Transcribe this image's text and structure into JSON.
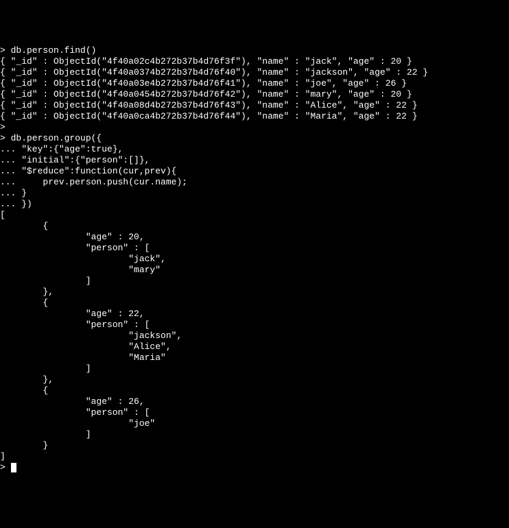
{
  "lines": [
    "> db.person.find()",
    "{ \"_id\" : ObjectId(\"4f40a02c4b272b37b4d76f3f\"), \"name\" : \"jack\", \"age\" : 20 }",
    "{ \"_id\" : ObjectId(\"4f40a0374b272b37b4d76f40\"), \"name\" : \"jackson\", \"age\" : 22 }",
    "{ \"_id\" : ObjectId(\"4f40a03e4b272b37b4d76f41\"), \"name\" : \"joe\", \"age\" : 26 }",
    "{ \"_id\" : ObjectId(\"4f40a0454b272b37b4d76f42\"), \"name\" : \"mary\", \"age\" : 20 }",
    "{ \"_id\" : ObjectId(\"4f40a08d4b272b37b4d76f43\"), \"name\" : \"Alice\", \"age\" : 22 }",
    "{ \"_id\" : ObjectId(\"4f40a0ca4b272b37b4d76f44\"), \"name\" : \"Maria\", \"age\" : 22 }",
    ">",
    "> db.person.group({",
    "... \"key\":{\"age\":true},",
    "... \"initial\":{\"person\":[]},",
    "... \"$reduce\":function(cur,prev){",
    "...     prev.person.push(cur.name);",
    "... }",
    "... })",
    "[",
    "        {",
    "                \"age\" : 20,",
    "                \"person\" : [",
    "                        \"jack\",",
    "                        \"mary\"",
    "                ]",
    "        },",
    "        {",
    "                \"age\" : 22,",
    "                \"person\" : [",
    "                        \"jackson\",",
    "                        \"Alice\",",
    "                        \"Maria\"",
    "                ]",
    "        },",
    "        {",
    "                \"age\" : 26,",
    "                \"person\" : [",
    "                        \"joe\"",
    "                ]",
    "        }",
    "]",
    "> "
  ],
  "cursor_on_last": true
}
